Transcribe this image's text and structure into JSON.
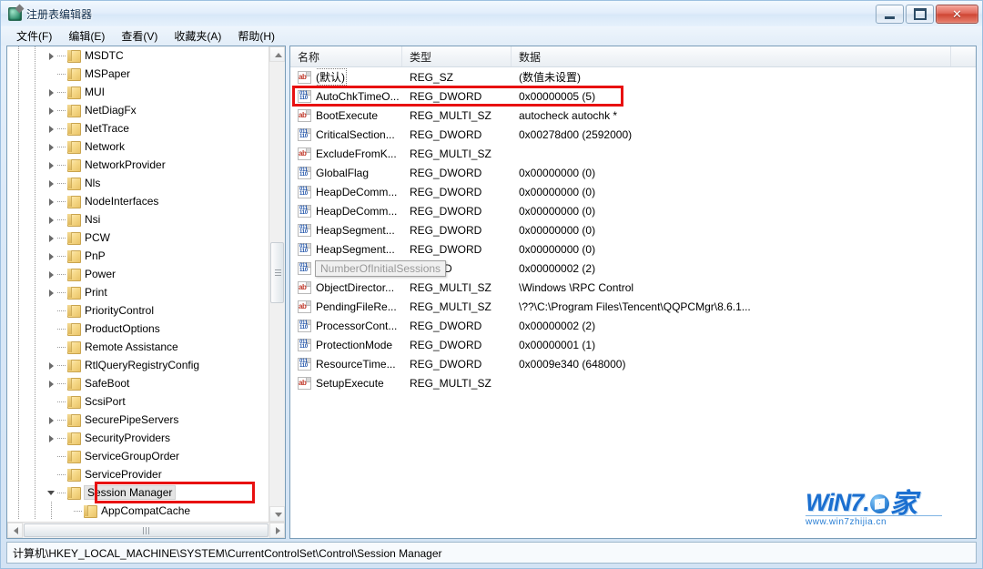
{
  "window": {
    "title": "注册表编辑器",
    "icon": "registry-editor-icon",
    "controls": {
      "minimize": "minimize-icon",
      "maximize": "maximize-icon",
      "close": "close-icon"
    }
  },
  "menu": {
    "items": [
      {
        "label": "文件(F)",
        "name": "menu-file"
      },
      {
        "label": "编辑(E)",
        "name": "menu-edit"
      },
      {
        "label": "查看(V)",
        "name": "menu-view"
      },
      {
        "label": "收藏夹(A)",
        "name": "menu-favorites"
      },
      {
        "label": "帮助(H)",
        "name": "menu-help"
      }
    ]
  },
  "tree": {
    "nodes": [
      {
        "label": "MSDTC",
        "indent": 3,
        "arrow": "collapsed",
        "selected": false
      },
      {
        "label": "MSPaper",
        "indent": 3,
        "arrow": "none",
        "selected": false
      },
      {
        "label": "MUI",
        "indent": 3,
        "arrow": "collapsed",
        "selected": false
      },
      {
        "label": "NetDiagFx",
        "indent": 3,
        "arrow": "collapsed",
        "selected": false
      },
      {
        "label": "NetTrace",
        "indent": 3,
        "arrow": "collapsed",
        "selected": false
      },
      {
        "label": "Network",
        "indent": 3,
        "arrow": "collapsed",
        "selected": false
      },
      {
        "label": "NetworkProvider",
        "indent": 3,
        "arrow": "collapsed",
        "selected": false
      },
      {
        "label": "Nls",
        "indent": 3,
        "arrow": "collapsed",
        "selected": false
      },
      {
        "label": "NodeInterfaces",
        "indent": 3,
        "arrow": "collapsed",
        "selected": false
      },
      {
        "label": "Nsi",
        "indent": 3,
        "arrow": "collapsed",
        "selected": false
      },
      {
        "label": "PCW",
        "indent": 3,
        "arrow": "collapsed",
        "selected": false
      },
      {
        "label": "PnP",
        "indent": 3,
        "arrow": "collapsed",
        "selected": false
      },
      {
        "label": "Power",
        "indent": 3,
        "arrow": "collapsed",
        "selected": false
      },
      {
        "label": "Print",
        "indent": 3,
        "arrow": "collapsed",
        "selected": false
      },
      {
        "label": "PriorityControl",
        "indent": 3,
        "arrow": "none",
        "selected": false
      },
      {
        "label": "ProductOptions",
        "indent": 3,
        "arrow": "none",
        "selected": false
      },
      {
        "label": "Remote Assistance",
        "indent": 3,
        "arrow": "none",
        "selected": false
      },
      {
        "label": "RtlQueryRegistryConfig",
        "indent": 3,
        "arrow": "collapsed",
        "selected": false
      },
      {
        "label": "SafeBoot",
        "indent": 3,
        "arrow": "collapsed",
        "selected": false
      },
      {
        "label": "ScsiPort",
        "indent": 3,
        "arrow": "none",
        "selected": false
      },
      {
        "label": "SecurePipeServers",
        "indent": 3,
        "arrow": "collapsed",
        "selected": false
      },
      {
        "label": "SecurityProviders",
        "indent": 3,
        "arrow": "collapsed",
        "selected": false
      },
      {
        "label": "ServiceGroupOrder",
        "indent": 3,
        "arrow": "none",
        "selected": false
      },
      {
        "label": "ServiceProvider",
        "indent": 3,
        "arrow": "none",
        "selected": false
      },
      {
        "label": "Session Manager",
        "indent": 3,
        "arrow": "expanded",
        "selected": true
      },
      {
        "label": "AppCompatCache",
        "indent": 4,
        "arrow": "none",
        "selected": false
      }
    ],
    "highlight_node": "Session Manager"
  },
  "list": {
    "columns": [
      {
        "label": "名称",
        "name": "column-name"
      },
      {
        "label": "类型",
        "name": "column-type"
      },
      {
        "label": "数据",
        "name": "column-data"
      }
    ],
    "rows": [
      {
        "name": "(默认)",
        "type": "REG_SZ",
        "data": "(数值未设置)",
        "icon": "string-value-icon",
        "default": true
      },
      {
        "name": "AutoChkTimeO...",
        "type": "REG_DWORD",
        "data": "0x00000005 (5)",
        "icon": "dword-value-icon"
      },
      {
        "name": "BootExecute",
        "type": "REG_MULTI_SZ",
        "data": "autocheck autochk *",
        "icon": "string-value-icon"
      },
      {
        "name": "CriticalSection...",
        "type": "REG_DWORD",
        "data": "0x00278d00 (2592000)",
        "icon": "dword-value-icon"
      },
      {
        "name": "ExcludeFromK...",
        "type": "REG_MULTI_SZ",
        "data": "",
        "icon": "string-value-icon"
      },
      {
        "name": "GlobalFlag",
        "type": "REG_DWORD",
        "data": "0x00000000 (0)",
        "icon": "dword-value-icon"
      },
      {
        "name": "HeapDeComm...",
        "type": "REG_DWORD",
        "data": "0x00000000 (0)",
        "icon": "dword-value-icon"
      },
      {
        "name": "HeapDeComm...",
        "type": "REG_DWORD",
        "data": "0x00000000 (0)",
        "icon": "dword-value-icon"
      },
      {
        "name": "HeapSegment...",
        "type": "REG_DWORD",
        "data": "0x00000000 (0)",
        "icon": "dword-value-icon"
      },
      {
        "name": "HeapSegment...",
        "type": "REG_DWORD",
        "data": "0x00000000 (0)",
        "icon": "dword-value-icon"
      },
      {
        "name": "",
        "type": "DWORD",
        "data": "0x00000002 (2)",
        "icon": "dword-value-icon",
        "tooltip": "NumberOfInitialSessions"
      },
      {
        "name": "ObjectDirector...",
        "type": "REG_MULTI_SZ",
        "data": "\\Windows \\RPC Control",
        "icon": "string-value-icon"
      },
      {
        "name": "PendingFileRe...",
        "type": "REG_MULTI_SZ",
        "data": "\\??\\C:\\Program Files\\Tencent\\QQPCMgr\\8.6.1...",
        "icon": "string-value-icon"
      },
      {
        "name": "ProcessorCont...",
        "type": "REG_DWORD",
        "data": "0x00000002 (2)",
        "icon": "dword-value-icon"
      },
      {
        "name": "ProtectionMode",
        "type": "REG_DWORD",
        "data": "0x00000001 (1)",
        "icon": "dword-value-icon"
      },
      {
        "name": "ResourceTime...",
        "type": "REG_DWORD",
        "data": "0x0009e340 (648000)",
        "icon": "dword-value-icon"
      },
      {
        "name": "SetupExecute",
        "type": "REG_MULTI_SZ",
        "data": "",
        "icon": "string-value-icon"
      }
    ],
    "highlight_row": "AutoChkTimeO...",
    "tooltip_text": "NumberOfInitialSessions"
  },
  "statusbar": {
    "path": "计算机\\HKEY_LOCAL_MACHINE\\SYSTEM\\CurrentControlSet\\Control\\Session Manager"
  },
  "watermark": {
    "main": "WiN7.",
    "cn": "家",
    "sub": "www.win7zhijia.cn"
  },
  "colors": {
    "highlight_red": "#e81010",
    "title_text": "#0b2a4a",
    "watermark_blue": "#1b6fd0"
  }
}
